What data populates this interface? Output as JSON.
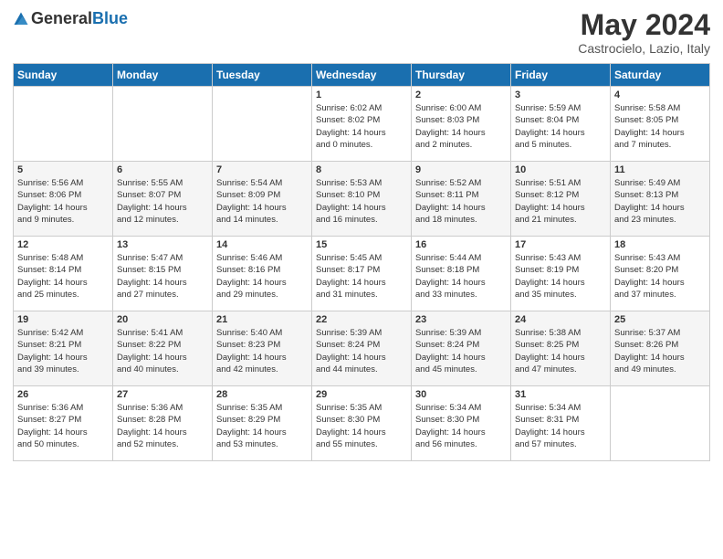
{
  "header": {
    "logo_general": "General",
    "logo_blue": "Blue",
    "month_year": "May 2024",
    "location": "Castrocielo, Lazio, Italy"
  },
  "weekdays": [
    "Sunday",
    "Monday",
    "Tuesday",
    "Wednesday",
    "Thursday",
    "Friday",
    "Saturday"
  ],
  "weeks": [
    [
      {
        "day": "",
        "info": ""
      },
      {
        "day": "",
        "info": ""
      },
      {
        "day": "",
        "info": ""
      },
      {
        "day": "1",
        "info": "Sunrise: 6:02 AM\nSunset: 8:02 PM\nDaylight: 14 hours\nand 0 minutes."
      },
      {
        "day": "2",
        "info": "Sunrise: 6:00 AM\nSunset: 8:03 PM\nDaylight: 14 hours\nand 2 minutes."
      },
      {
        "day": "3",
        "info": "Sunrise: 5:59 AM\nSunset: 8:04 PM\nDaylight: 14 hours\nand 5 minutes."
      },
      {
        "day": "4",
        "info": "Sunrise: 5:58 AM\nSunset: 8:05 PM\nDaylight: 14 hours\nand 7 minutes."
      }
    ],
    [
      {
        "day": "5",
        "info": "Sunrise: 5:56 AM\nSunset: 8:06 PM\nDaylight: 14 hours\nand 9 minutes."
      },
      {
        "day": "6",
        "info": "Sunrise: 5:55 AM\nSunset: 8:07 PM\nDaylight: 14 hours\nand 12 minutes."
      },
      {
        "day": "7",
        "info": "Sunrise: 5:54 AM\nSunset: 8:09 PM\nDaylight: 14 hours\nand 14 minutes."
      },
      {
        "day": "8",
        "info": "Sunrise: 5:53 AM\nSunset: 8:10 PM\nDaylight: 14 hours\nand 16 minutes."
      },
      {
        "day": "9",
        "info": "Sunrise: 5:52 AM\nSunset: 8:11 PM\nDaylight: 14 hours\nand 18 minutes."
      },
      {
        "day": "10",
        "info": "Sunrise: 5:51 AM\nSunset: 8:12 PM\nDaylight: 14 hours\nand 21 minutes."
      },
      {
        "day": "11",
        "info": "Sunrise: 5:49 AM\nSunset: 8:13 PM\nDaylight: 14 hours\nand 23 minutes."
      }
    ],
    [
      {
        "day": "12",
        "info": "Sunrise: 5:48 AM\nSunset: 8:14 PM\nDaylight: 14 hours\nand 25 minutes."
      },
      {
        "day": "13",
        "info": "Sunrise: 5:47 AM\nSunset: 8:15 PM\nDaylight: 14 hours\nand 27 minutes."
      },
      {
        "day": "14",
        "info": "Sunrise: 5:46 AM\nSunset: 8:16 PM\nDaylight: 14 hours\nand 29 minutes."
      },
      {
        "day": "15",
        "info": "Sunrise: 5:45 AM\nSunset: 8:17 PM\nDaylight: 14 hours\nand 31 minutes."
      },
      {
        "day": "16",
        "info": "Sunrise: 5:44 AM\nSunset: 8:18 PM\nDaylight: 14 hours\nand 33 minutes."
      },
      {
        "day": "17",
        "info": "Sunrise: 5:43 AM\nSunset: 8:19 PM\nDaylight: 14 hours\nand 35 minutes."
      },
      {
        "day": "18",
        "info": "Sunrise: 5:43 AM\nSunset: 8:20 PM\nDaylight: 14 hours\nand 37 minutes."
      }
    ],
    [
      {
        "day": "19",
        "info": "Sunrise: 5:42 AM\nSunset: 8:21 PM\nDaylight: 14 hours\nand 39 minutes."
      },
      {
        "day": "20",
        "info": "Sunrise: 5:41 AM\nSunset: 8:22 PM\nDaylight: 14 hours\nand 40 minutes."
      },
      {
        "day": "21",
        "info": "Sunrise: 5:40 AM\nSunset: 8:23 PM\nDaylight: 14 hours\nand 42 minutes."
      },
      {
        "day": "22",
        "info": "Sunrise: 5:39 AM\nSunset: 8:24 PM\nDaylight: 14 hours\nand 44 minutes."
      },
      {
        "day": "23",
        "info": "Sunrise: 5:39 AM\nSunset: 8:24 PM\nDaylight: 14 hours\nand 45 minutes."
      },
      {
        "day": "24",
        "info": "Sunrise: 5:38 AM\nSunset: 8:25 PM\nDaylight: 14 hours\nand 47 minutes."
      },
      {
        "day": "25",
        "info": "Sunrise: 5:37 AM\nSunset: 8:26 PM\nDaylight: 14 hours\nand 49 minutes."
      }
    ],
    [
      {
        "day": "26",
        "info": "Sunrise: 5:36 AM\nSunset: 8:27 PM\nDaylight: 14 hours\nand 50 minutes."
      },
      {
        "day": "27",
        "info": "Sunrise: 5:36 AM\nSunset: 8:28 PM\nDaylight: 14 hours\nand 52 minutes."
      },
      {
        "day": "28",
        "info": "Sunrise: 5:35 AM\nSunset: 8:29 PM\nDaylight: 14 hours\nand 53 minutes."
      },
      {
        "day": "29",
        "info": "Sunrise: 5:35 AM\nSunset: 8:30 PM\nDaylight: 14 hours\nand 55 minutes."
      },
      {
        "day": "30",
        "info": "Sunrise: 5:34 AM\nSunset: 8:30 PM\nDaylight: 14 hours\nand 56 minutes."
      },
      {
        "day": "31",
        "info": "Sunrise: 5:34 AM\nSunset: 8:31 PM\nDaylight: 14 hours\nand 57 minutes."
      },
      {
        "day": "",
        "info": ""
      }
    ]
  ]
}
